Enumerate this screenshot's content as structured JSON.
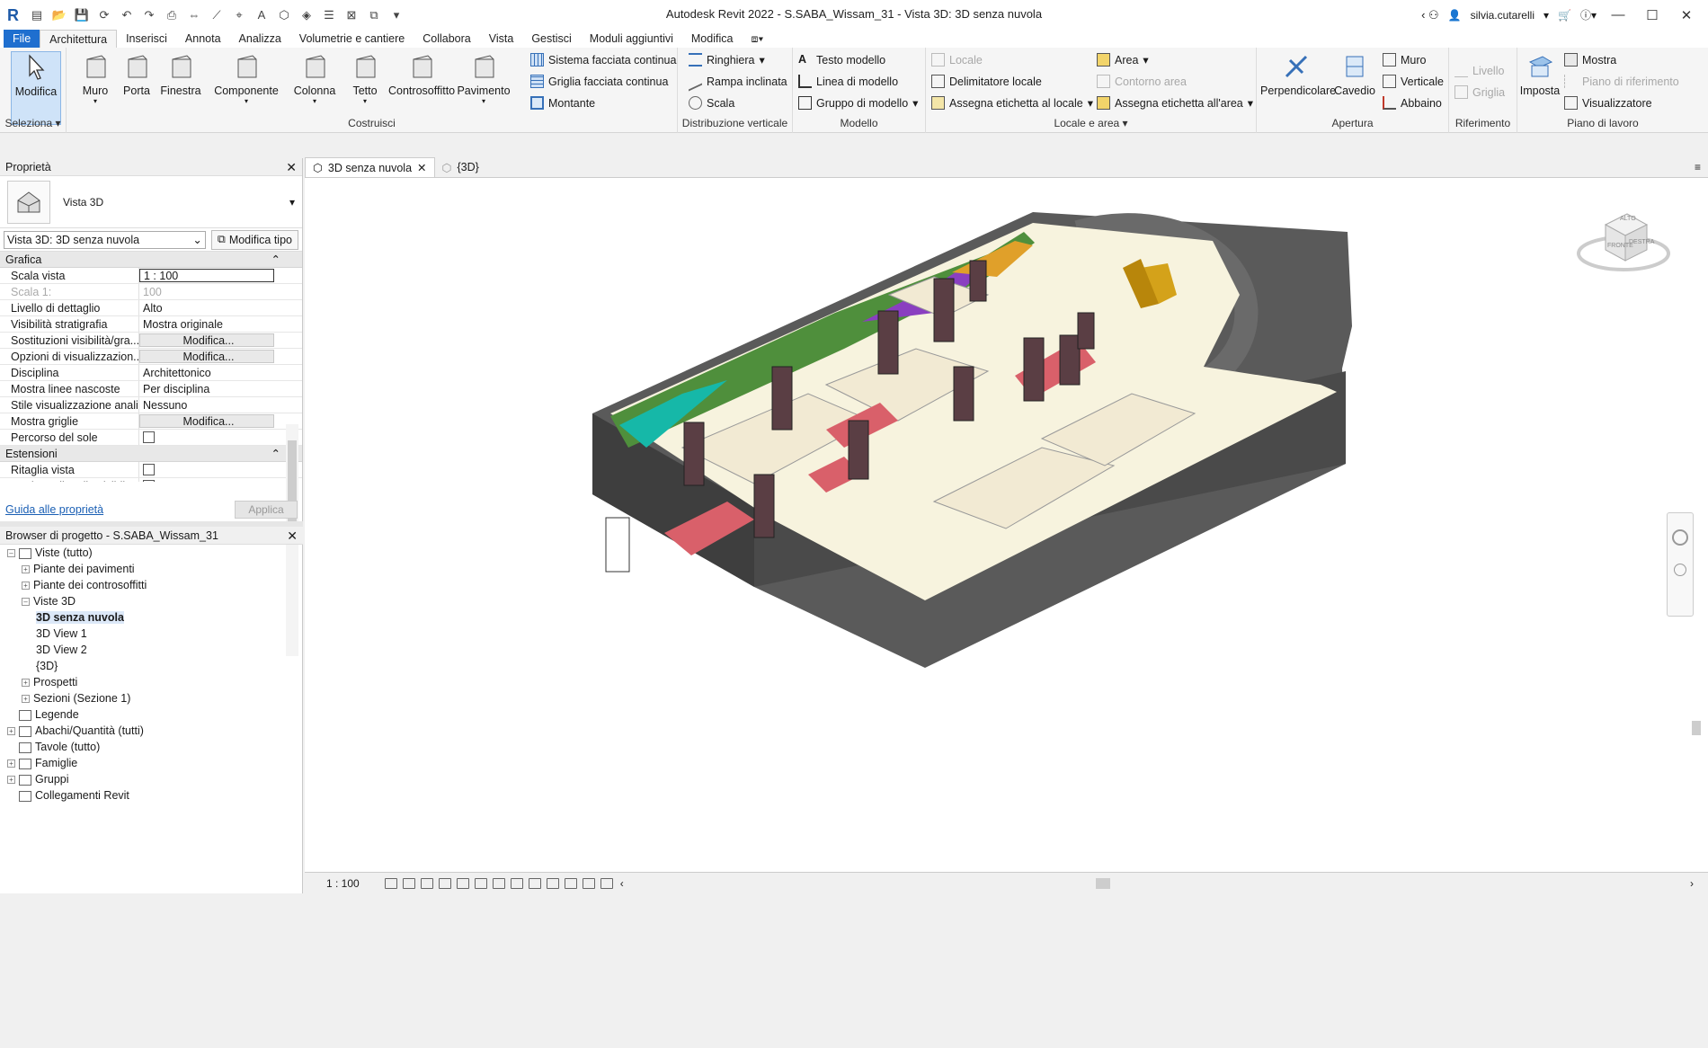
{
  "app": {
    "title": "Autodesk Revit 2022 - S.SABA_Wissam_31 - Vista 3D: 3D senza nuvola",
    "user": "silvia.cutarelli",
    "logo": "R"
  },
  "ribbon_tabs": [
    "File",
    "Architettura",
    "Inserisci",
    "Annota",
    "Analizza",
    "Volumetrie e cantiere",
    "Collabora",
    "Vista",
    "Gestisci",
    "Moduli aggiuntivi",
    "Modifica"
  ],
  "active_tab": "Architettura",
  "panels": {
    "seleziona": {
      "label": "Seleziona",
      "modifica": "Modifica"
    },
    "costruisci": {
      "label": "Costruisci",
      "buttons": [
        "Muro",
        "Porta",
        "Finestra",
        "Componente",
        "Colonna",
        "Tetto",
        "Controsoffitto",
        "Pavimento"
      ],
      "small": [
        "Sistema facciata continua",
        "Griglia facciata continua",
        "Montante"
      ]
    },
    "distribuzione": {
      "label": "Distribuzione verticale",
      "small": [
        "Ringhiera",
        "Rampa inclinata",
        "Scala"
      ]
    },
    "modello": {
      "label": "Modello",
      "small": [
        "Testo modello",
        "Linea di modello",
        "Gruppo di modello"
      ]
    },
    "locale": {
      "label": "Locale e area",
      "small": [
        "Locale",
        "Delimitatore  locale",
        "Assegna etichetta  al locale",
        "Area",
        "Contorno  area",
        "Assegna etichetta  all'area"
      ]
    },
    "apertura": {
      "label": "Apertura",
      "buttons": [
        "Perpendicolare",
        "Cavedio"
      ],
      "small": [
        "Muro",
        "Verticale",
        "Abbaino"
      ]
    },
    "riferimento": {
      "label": "Riferimento",
      "small": [
        "Livello",
        "Griglia"
      ]
    },
    "piano": {
      "label": "Piano di lavoro",
      "buttons": [
        "Imposta"
      ],
      "small": [
        "Mostra",
        "Piano di riferimento",
        "Visualizzatore"
      ]
    }
  },
  "properties": {
    "header": "Proprietà",
    "type_name": "Vista 3D",
    "instance": "Vista 3D: 3D senza nuvola",
    "edit_type": "Modifica tipo",
    "group_grafica": "Grafica",
    "rows": [
      {
        "k": "Scala vista",
        "v": "1 : 100",
        "kind": "inp"
      },
      {
        "k": "Scala  1:",
        "v": "100",
        "kind": "dis"
      },
      {
        "k": "Livello di dettaglio",
        "v": "Alto",
        "kind": "txt"
      },
      {
        "k": "Visibilità stratigrafia",
        "v": "Mostra originale",
        "kind": "txt"
      },
      {
        "k": "Sostituzioni visibilità/gra...",
        "v": "Modifica...",
        "kind": "btn"
      },
      {
        "k": "Opzioni di visualizzazion...",
        "v": "Modifica...",
        "kind": "btn"
      },
      {
        "k": "Disciplina",
        "v": "Architettonico",
        "kind": "txt"
      },
      {
        "k": "Mostra linee nascoste",
        "v": "Per disciplina",
        "kind": "txt"
      },
      {
        "k": "Stile visualizzazione anali...",
        "v": "Nessuno",
        "kind": "txt"
      },
      {
        "k": "Mostra griglie",
        "v": "Modifica...",
        "kind": "btn"
      },
      {
        "k": "Percorso del sole",
        "v": "",
        "kind": "chk"
      }
    ],
    "group_estensioni": "Estensioni",
    "rows2": [
      {
        "k": "Ritaglia vista",
        "v": "",
        "kind": "chk"
      },
      {
        "k": "Regione di taglio visibile",
        "v": "",
        "kind": "chk"
      }
    ],
    "help_link": "Guida alle proprietà",
    "apply": "Applica"
  },
  "browser": {
    "header": "Browser di progetto - S.SABA_Wissam_31",
    "tree": [
      {
        "label": "Viste (tutto)",
        "lvl": 0,
        "tg": "–"
      },
      {
        "label": "Piante dei pavimenti",
        "lvl": 1,
        "tg": "+"
      },
      {
        "label": "Piante dei controsoffitti",
        "lvl": 1,
        "tg": "+"
      },
      {
        "label": "Viste 3D",
        "lvl": 1,
        "tg": "–"
      },
      {
        "label": "3D senza nuvola",
        "lvl": 2,
        "tg": "",
        "sel": true
      },
      {
        "label": "3D View 1",
        "lvl": 2,
        "tg": ""
      },
      {
        "label": "3D View 2",
        "lvl": 2,
        "tg": ""
      },
      {
        "label": "{3D}",
        "lvl": 2,
        "tg": ""
      },
      {
        "label": "Prospetti",
        "lvl": 1,
        "tg": "+"
      },
      {
        "label": "Sezioni (Sezione 1)",
        "lvl": 1,
        "tg": "+"
      },
      {
        "label": "Legende",
        "lvl": 0,
        "tg": ""
      },
      {
        "label": "Abachi/Quantità (tutti)",
        "lvl": 0,
        "tg": "+"
      },
      {
        "label": "Tavole (tutto)",
        "lvl": 0,
        "tg": ""
      },
      {
        "label": "Famiglie",
        "lvl": 0,
        "tg": "+"
      },
      {
        "label": "Gruppi",
        "lvl": 0,
        "tg": "+"
      },
      {
        "label": "Collegamenti Revit",
        "lvl": 0,
        "tg": ""
      }
    ]
  },
  "view_tabs": [
    "3D senza nuvola",
    "{3D}"
  ],
  "viewcube": {
    "top": "ALTO",
    "front": "FRONTE",
    "right": "DESTRA"
  },
  "status": {
    "scale": "1 : 100"
  }
}
